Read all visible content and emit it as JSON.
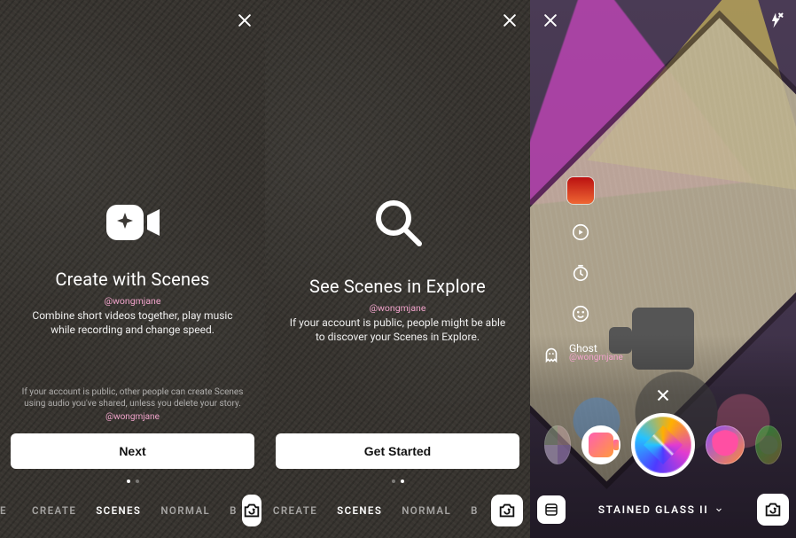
{
  "watermark": "@wongmjane",
  "panels": {
    "one": {
      "title": "Create with Scenes",
      "subtitle": "Combine short videos together, play music while recording and change speed.",
      "footnote": "If your account is public, other people can create Scenes using audio you've shared, unless you delete your story.",
      "cta": "Next",
      "modes": {
        "left_cut": "E",
        "create": "CREATE",
        "scenes": "SCENES",
        "normal": "NORMAL",
        "right_cut": "B"
      },
      "page_index": 0
    },
    "two": {
      "title": "See Scenes in Explore",
      "subtitle": "If your account is public, people might be able to discover your Scenes in Explore.",
      "cta": "Get Started",
      "modes": {
        "create": "CREATE",
        "scenes": "SCENES",
        "normal": "NORMAL",
        "right_cut": "B"
      },
      "page_index": 1
    },
    "three": {
      "side_tools": {
        "ghost_label": "Ghost"
      },
      "effect_name": "STAINED GLASS II"
    }
  }
}
